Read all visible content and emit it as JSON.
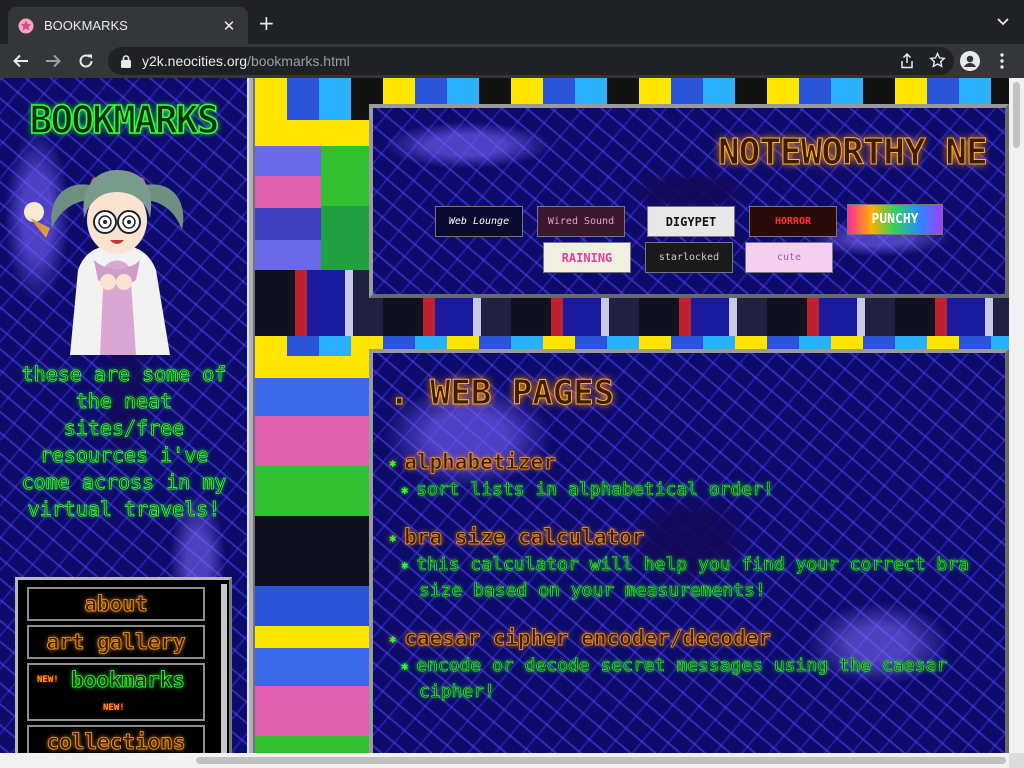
{
  "browser": {
    "tab_title": "BOOKMARKS",
    "url_host": "y2k.neocities.org",
    "url_path": "/bookmarks.html"
  },
  "sidebar": {
    "title": "BOOKMARKS",
    "blurb": "these are some of the neat sites/free resources i've come across in my virtual travels!",
    "nav": [
      {
        "label": "about"
      },
      {
        "label": "art gallery"
      },
      {
        "label": "bookmarks",
        "badge": "NEW!"
      },
      {
        "label": "collections"
      }
    ]
  },
  "noteworthy": {
    "heading": "NOTEWORTHY NE",
    "buttons": [
      {
        "label": "Web Lounge"
      },
      {
        "label": "Wired Sound"
      },
      {
        "label": "DIGYPET"
      },
      {
        "label": "HORROR"
      },
      {
        "label": "PUNCHY"
      },
      {
        "label": "RAINING"
      },
      {
        "label": "starlocked"
      },
      {
        "label": "cute"
      }
    ]
  },
  "main": {
    "heading": ". WEB PAGES",
    "links": [
      {
        "title": "alphabetizer",
        "desc": "sort lists in alphabetical order!"
      },
      {
        "title": "bra size calculator",
        "desc": "this calculator will help you find your correct bra size based on your measurements!"
      },
      {
        "title": "caesar cipher encoder/decoder",
        "desc": "encode or decode secret messages using the caesar cipher!"
      }
    ]
  },
  "colors": {
    "neon_green": "#38ff38",
    "neon_orange": "#ffa020",
    "chrome_dark": "#202124",
    "chrome_mid": "#35363a"
  }
}
